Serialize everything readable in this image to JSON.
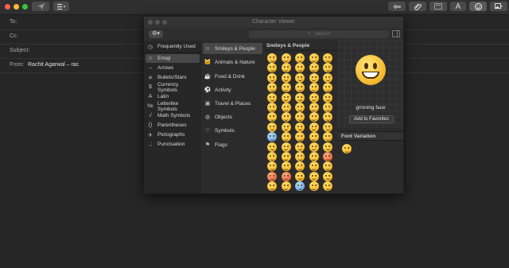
{
  "mail": {
    "to_label": "To:",
    "cc_label": "Cc:",
    "subject_label": "Subject:",
    "from_label": "From:",
    "from_value": "Rachit Agarwal – rac"
  },
  "toolbar": {
    "buttons": [
      "send-icon",
      "list-icon",
      "reply-icon",
      "attach-icon",
      "format-icon",
      "font-icon",
      "emoji-icon",
      "photo-icon"
    ],
    "font_label": "A"
  },
  "viewer": {
    "title": "Character Viewer",
    "search_placeholder": "Search",
    "categories": [
      {
        "label": "Frequently Used",
        "icon": "clock-icon"
      },
      {
        "label": "Emoji",
        "icon": "smiley-icon"
      },
      {
        "label": "Arrows",
        "icon": "arrow-icon"
      },
      {
        "label": "Bullets/Stars",
        "icon": "asterisk-icon"
      },
      {
        "label": "Currency Symbols",
        "icon": "dollar-icon"
      },
      {
        "label": "Latin",
        "icon": "letter-a-icon"
      },
      {
        "label": "Letterlike Symbols",
        "icon": "numero-icon"
      },
      {
        "label": "Math Symbols",
        "icon": "sqrt-icon"
      },
      {
        "label": "Parentheses",
        "icon": "parentheses-icon"
      },
      {
        "label": "Pictographs",
        "icon": "pictograph-icon"
      },
      {
        "label": "Punctuation",
        "icon": "punctuation-icon"
      }
    ],
    "subcategories": [
      {
        "label": "Smileys & People",
        "icon": "smiley-icon"
      },
      {
        "label": "Animals & Nature",
        "icon": "cat-icon"
      },
      {
        "label": "Food & Drink",
        "icon": "cup-icon"
      },
      {
        "label": "Activity",
        "icon": "ball-icon"
      },
      {
        "label": "Travel & Places",
        "icon": "bus-icon"
      },
      {
        "label": "Objects",
        "icon": "bulb-icon"
      },
      {
        "label": "Symbols",
        "icon": "symbols-icon"
      },
      {
        "label": "Flags",
        "icon": "flag-icon"
      }
    ],
    "grid_heading": "Smileys & People",
    "selected_name": "grinning face",
    "add_favorites": "Add to Favorites",
    "font_variation": "Font Variation"
  },
  "colors": {
    "background": "#262626",
    "selection": "#484848",
    "emoji_yellow": "#f4b52a"
  }
}
